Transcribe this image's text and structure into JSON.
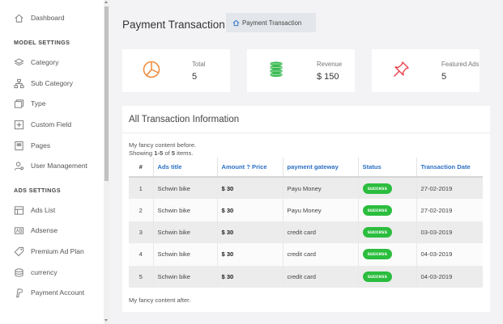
{
  "sidebar": {
    "dashboard": "Dashboard",
    "section_model": "MODEL SETTINGS",
    "category": "Category",
    "sub_category": "Sub Category",
    "type": "Type",
    "custom_field": "Custom Field",
    "pages": "Pages",
    "user_management": "User Management",
    "section_ads": "ADS SETTINGS",
    "ads_list": "Ads List",
    "adsense": "Adsense",
    "premium_ad_plan": "Premium Ad Plan",
    "currency": "currency",
    "payment_account": "Payment Account"
  },
  "header": {
    "title": "Payment Transaction",
    "breadcrumb": "Payment Transaction"
  },
  "stats": {
    "total_label": "Total",
    "total_value": "5",
    "revenue_label": "Revenue",
    "revenue_value": "$ 150",
    "featured_label": "Featured Ads",
    "featured_value": "5"
  },
  "panel": {
    "title": "All Transaction Information",
    "before": "My fancy content before.",
    "showing_prefix": "Showing ",
    "showing_range": "1-5",
    "showing_mid": " of ",
    "showing_total": "5",
    "showing_suffix": " items.",
    "after": "My fancy content after."
  },
  "table": {
    "headers": [
      "#",
      "Ads title",
      "Amount ? Price",
      "payment gateway",
      "Status",
      "Transaction Date"
    ],
    "rows": [
      {
        "num": "1",
        "title": "Schwin bike",
        "amount": "$ 30",
        "gateway": "Payu Money",
        "status": "success",
        "date": "27-02-2019"
      },
      {
        "num": "2",
        "title": "Schwin bike",
        "amount": "$ 30",
        "gateway": "Payu Money",
        "status": "success",
        "date": "27-02-2019"
      },
      {
        "num": "3",
        "title": "Schwin bike",
        "amount": "$ 30",
        "gateway": "credit card",
        "status": "success",
        "date": "03-03-2019"
      },
      {
        "num": "4",
        "title": "Schwin bike",
        "amount": "$ 30",
        "gateway": "credit card",
        "status": "success",
        "date": "04-03-2019"
      },
      {
        "num": "5",
        "title": "Schwin bike",
        "amount": "$ 30",
        "gateway": "credit card",
        "status": "success",
        "date": "04-03-2019"
      }
    ]
  },
  "colors": {
    "header_link": "#2a6fc4",
    "success": "#2bbd3e",
    "stat_total": "#f0893a",
    "stat_revenue": "#3cba54",
    "stat_featured": "#e8414b"
  },
  "icons": {
    "dashboard": "home-icon",
    "category": "layers-icon",
    "sub_category": "hierarchy-icon",
    "type": "folders-icon",
    "custom_field": "add-box-icon",
    "pages": "page-icon",
    "user_management": "user-gear-icon",
    "ads_list": "grid-icon",
    "adsense": "ad-icon",
    "premium_ad_plan": "tag-icon",
    "currency": "coins-icon",
    "payment_account": "paypal-icon"
  }
}
